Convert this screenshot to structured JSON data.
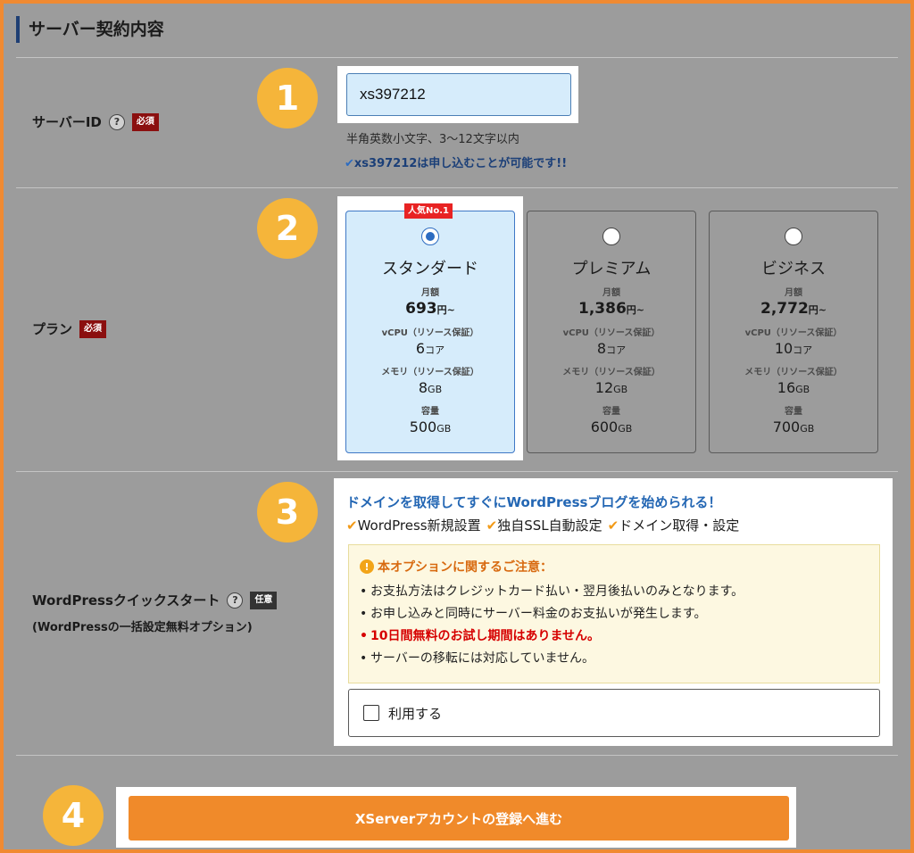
{
  "section": {
    "title": "サーバー契約内容"
  },
  "server_id": {
    "label": "サーバーID",
    "help": "?",
    "required": "必須",
    "value": "xs397212",
    "hint": "半角英数小文字、3～12文字以内",
    "ok_message": "xs397212は申し込むことが可能です!!",
    "step": "1"
  },
  "plan": {
    "label": "プラン",
    "required": "必須",
    "step": "2",
    "popular_badge": "人気No.1",
    "price_label": "月額",
    "price_unit": "円~",
    "vcpu_label": "vCPU（リソース保証）",
    "vcpu_unit": "コア",
    "memory_label": "メモリ（リソース保証）",
    "memory_unit": "GB",
    "storage_label": "容量",
    "storage_unit": "GB",
    "options": [
      {
        "name": "スタンダード",
        "price": "693",
        "vcpu": "6",
        "memory": "8",
        "storage": "500",
        "selected": true
      },
      {
        "name": "プレミアム",
        "price": "1,386",
        "vcpu": "8",
        "memory": "12",
        "storage": "600",
        "selected": false
      },
      {
        "name": "ビジネス",
        "price": "2,772",
        "vcpu": "10",
        "memory": "16",
        "storage": "700",
        "selected": false
      }
    ]
  },
  "wordpress": {
    "label": "WordPressクイックスタート",
    "help": "?",
    "optional": "任意",
    "sublabel": "(WordPressの一括設定無料オプション)",
    "step": "3",
    "headline": "ドメインを取得してすぐにWordPressブログを始められる！",
    "features": [
      "WordPress新規設置",
      "独自SSL自動設定",
      "ドメイン取得・設定"
    ],
    "notice_title": "本オプションに関するご注意：",
    "notice_items": [
      "お支払方法はクレジットカード払い・翌月後払いのみとなります。",
      "お申し込みと同時にサーバー料金のお支払いが発生します。",
      "10日間無料のお試し期間はありません。",
      "サーバーの移転には対応していません。"
    ],
    "use_label": "利用する"
  },
  "submit": {
    "label": "XServerアカウントの登録へ進む",
    "step": "4"
  },
  "colors": {
    "accent": "#f08a2a",
    "badge_bg": "#f5b53a",
    "selected_bg": "#d6ecfb",
    "link_blue": "#2467b4",
    "warning_red": "#d60000"
  }
}
